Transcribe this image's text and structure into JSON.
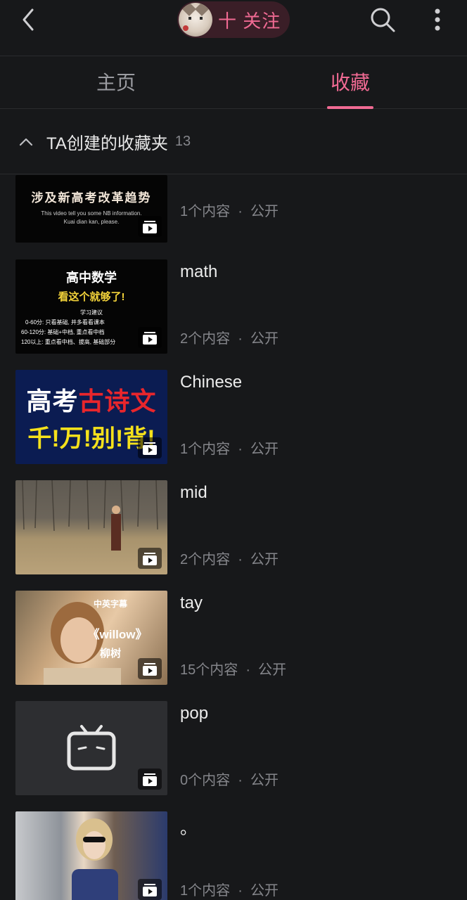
{
  "header": {
    "follow_label": "十 关注"
  },
  "tabs": [
    {
      "label": "主页"
    },
    {
      "label": "收藏"
    }
  ],
  "section": {
    "title": "TA创建的收藏夹",
    "count": "13"
  },
  "folders": [
    {
      "title": "",
      "meta": "1个内容  ·  公开",
      "thumb_text": [
        "涉及新高考改革趋势",
        "This video tell you some NB information.",
        "Kuai dian kan, please."
      ]
    },
    {
      "title": "math",
      "meta": "2个内容  ·  公开",
      "thumb_text": [
        "高中数学",
        "看这个就够了!",
        "学习建议",
        "0-60分: 只看基础, 并多看看课本",
        "60-120分: 基础+中档, 重点看中档",
        "120以上: 重点看中档、拔高, 基础部分"
      ]
    },
    {
      "title": "Chinese",
      "meta": "1个内容  ·  公开",
      "thumb_text": [
        "高考",
        "古诗文",
        "千!万!别!背!"
      ]
    },
    {
      "title": "mid",
      "meta": "2个内容  ·  公开",
      "thumb_text": []
    },
    {
      "title": "tay",
      "meta": "15个内容  ·  公开",
      "thumb_text": [
        "中英字幕",
        "《willow》",
        "柳树"
      ]
    },
    {
      "title": "pop",
      "meta": "0个内容  ·  公开",
      "thumb_text": []
    },
    {
      "title": "。",
      "meta": "1个内容  ·  公开",
      "thumb_text": []
    }
  ],
  "colors": {
    "accent": "#f06a93",
    "background": "#17181a",
    "muted_text": "#85868b"
  }
}
